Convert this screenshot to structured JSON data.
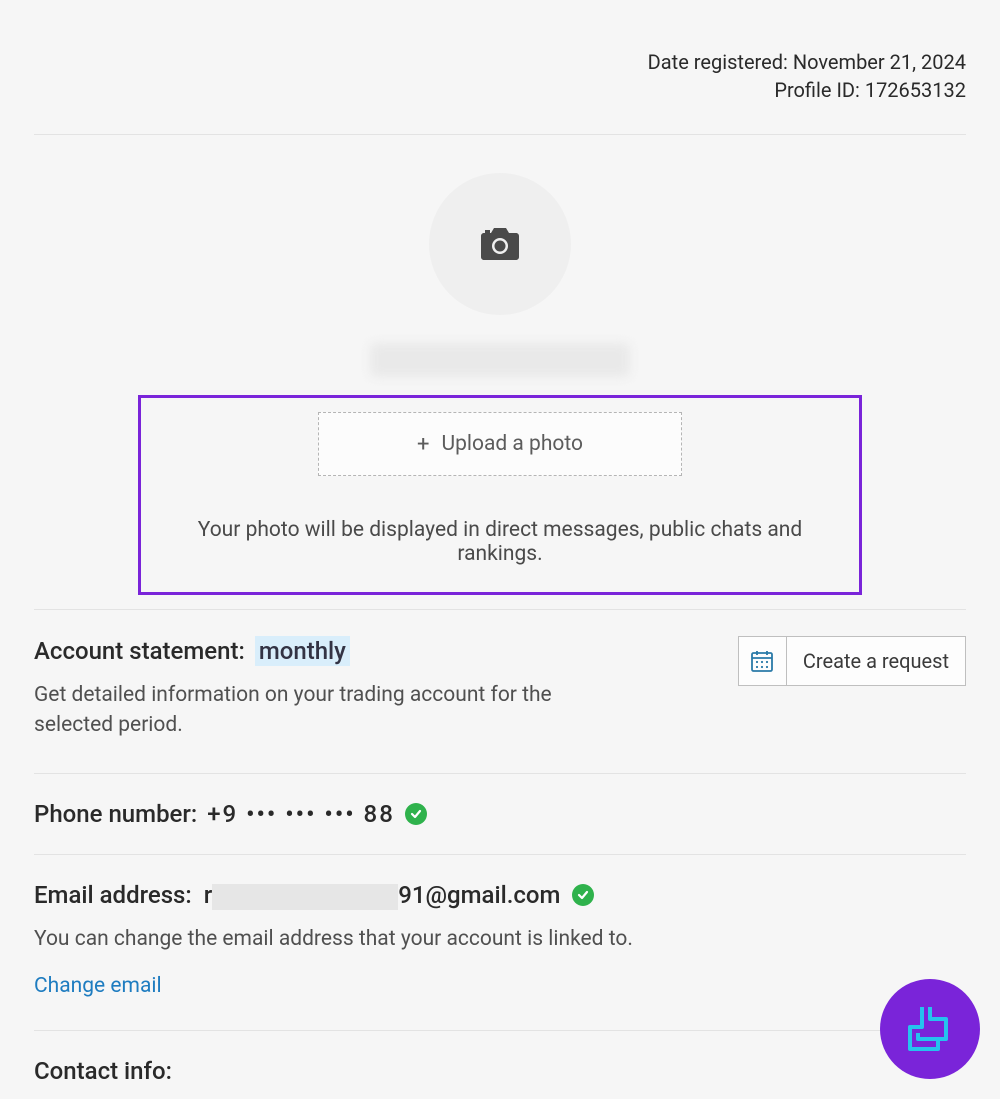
{
  "meta": {
    "date_registered_label": "Date registered:",
    "date_registered_value": "November 21, 2024",
    "profile_id_label": "Profile ID:",
    "profile_id_value": "172653132"
  },
  "upload": {
    "button_label": "Upload a photo",
    "note": "Your photo will be displayed in direct messages, public chats and rankings."
  },
  "account_statement": {
    "label": "Account statement:",
    "period": "monthly",
    "desc": "Get detailed information on your trading account for the selected period.",
    "create_request": "Create a request"
  },
  "phone": {
    "label": "Phone number:",
    "value": "+9 ••• ••• ••• 88"
  },
  "email": {
    "label": "Email address:",
    "prefix": "r",
    "suffix": "91@gmail.com",
    "desc": "You can change the email address that your account is linked to.",
    "change_link": "Change email"
  },
  "contact": {
    "label": "Contact info:"
  },
  "colors": {
    "highlight_border": "#7a24d9",
    "verified_green": "#2fb24c",
    "link_blue": "#1e7cc0"
  }
}
